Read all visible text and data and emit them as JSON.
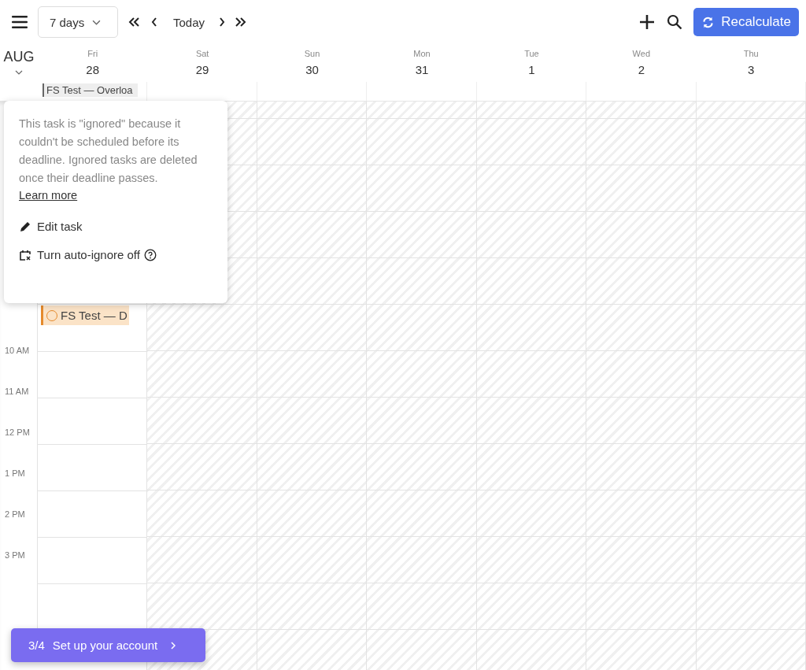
{
  "toolbar": {
    "view_select": "7 days",
    "today": "Today",
    "recalculate": "Recalculate"
  },
  "month": "AUG",
  "days": [
    {
      "weekday": "Fri",
      "date": "28",
      "unavailable": false,
      "all_day": [
        "FS Test — Overloa"
      ],
      "events": [
        {
          "title": "FS Test — D"
        }
      ]
    },
    {
      "weekday": "Sat",
      "date": "29",
      "unavailable": true
    },
    {
      "weekday": "Sun",
      "date": "30",
      "unavailable": true
    },
    {
      "weekday": "Mon",
      "date": "31",
      "unavailable": true
    },
    {
      "weekday": "Tue",
      "date": "1",
      "unavailable": true
    },
    {
      "weekday": "Wed",
      "date": "2",
      "unavailable": true
    },
    {
      "weekday": "Thu",
      "date": "3",
      "unavailable": true
    }
  ],
  "time_labels": [
    "10 AM",
    "11 AM",
    "12 PM",
    "1 PM",
    "2 PM",
    "3 PM"
  ],
  "popup": {
    "message": "This task is \"ignored\" because it couldn't be scheduled before its deadline. Ignored tasks are deleted once their deadline passes.",
    "link": "Learn more",
    "actions": [
      {
        "kind": "edit",
        "label": "Edit task",
        "help": false
      },
      {
        "kind": "auto_ignore",
        "label": "Turn auto-ignore off",
        "help": true
      }
    ]
  },
  "onboarding": {
    "step": "3/4",
    "label": "Set up your account"
  }
}
